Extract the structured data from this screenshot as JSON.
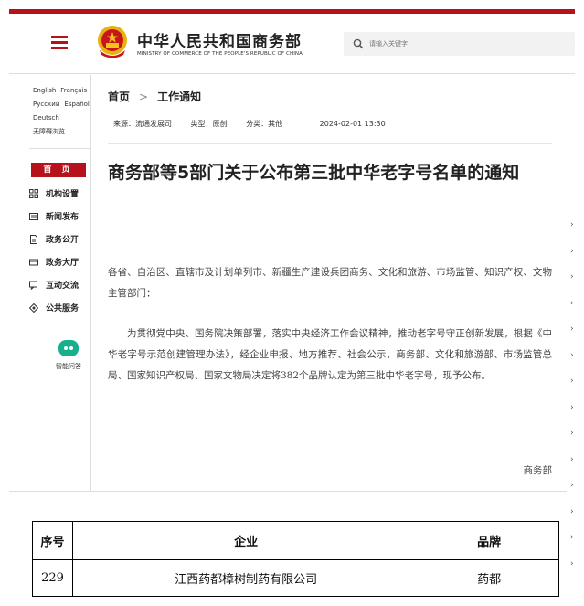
{
  "header": {
    "title": "中华人民共和国商务部",
    "subtitle": "MINISTRY OF COMMERCE OF THE PEOPLE'S REPUBLIC OF CHINA",
    "search_placeholder": "请输入关键字",
    "accent_color": "#b5121b"
  },
  "sidebar": {
    "languages": [
      "English",
      "Français",
      "Русский",
      "Español",
      "Deutsch",
      "无障碍浏览"
    ],
    "home_label": "首 页",
    "items": [
      {
        "label": "机构设置",
        "icon": "grid-icon"
      },
      {
        "label": "新闻发布",
        "icon": "news-icon"
      },
      {
        "label": "政务公开",
        "icon": "document-icon"
      },
      {
        "label": "政务大厅",
        "icon": "hall-icon"
      },
      {
        "label": "互动交流",
        "icon": "chat-icon"
      },
      {
        "label": "公共服务",
        "icon": "service-icon"
      }
    ],
    "bot_label": "智能问答"
  },
  "breadcrumb": {
    "home": "首页",
    "current": "工作通知"
  },
  "meta": {
    "source": "来源：流通发展司",
    "type": "类型：原创",
    "category": "分类：其他",
    "date": "2024-02-01 13:30"
  },
  "article": {
    "title": "商务部等5部门关于公布第三批中华老字号名单的通知",
    "recipients": "各省、自治区、直辖市及计划单列市、新疆生产建设兵团商务、文化和旅游、市场监管、知识产权、文物主管部门：",
    "body": "为贯彻党中央、国务院决策部署，落实中央经济工作会议精神，推动老字号守正创新发展，根据《中华老字号示范创建管理办法》，经企业申报、地方推荐、社会公示，商务部、文化和旅游部、市场监管总局、国家知识产权局、国家文物局决定将382个品牌认定为第三批中华老字号，现予公布。",
    "signature": "商务部"
  },
  "table": {
    "headers": [
      "序号",
      "企业",
      "品牌"
    ],
    "rows": [
      [
        "229",
        "江西药都樟树制药有限公司",
        "药都"
      ]
    ]
  }
}
